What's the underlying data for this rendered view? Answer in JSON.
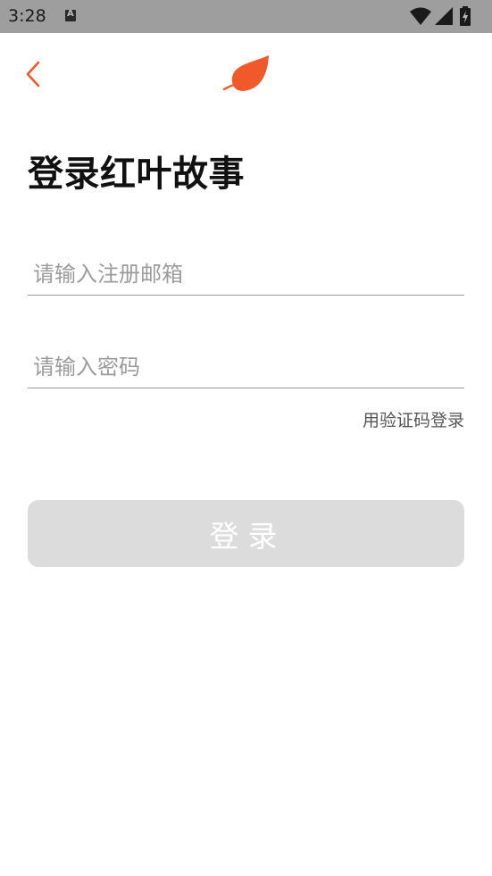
{
  "status_bar": {
    "time": "3:28",
    "icons": [
      "keyboard-a-icon",
      "wifi-icon",
      "signal-icon",
      "battery-charging-icon"
    ]
  },
  "header": {
    "back_icon": "chevron-left-icon",
    "logo_icon": "leaf-icon",
    "accent_color": "#f05a2b"
  },
  "page": {
    "title": "登录红叶故事"
  },
  "form": {
    "email_placeholder": "请输入注册邮箱",
    "password_placeholder": "请输入密码",
    "code_login_link": "用验证码登录",
    "login_button": "登录"
  }
}
